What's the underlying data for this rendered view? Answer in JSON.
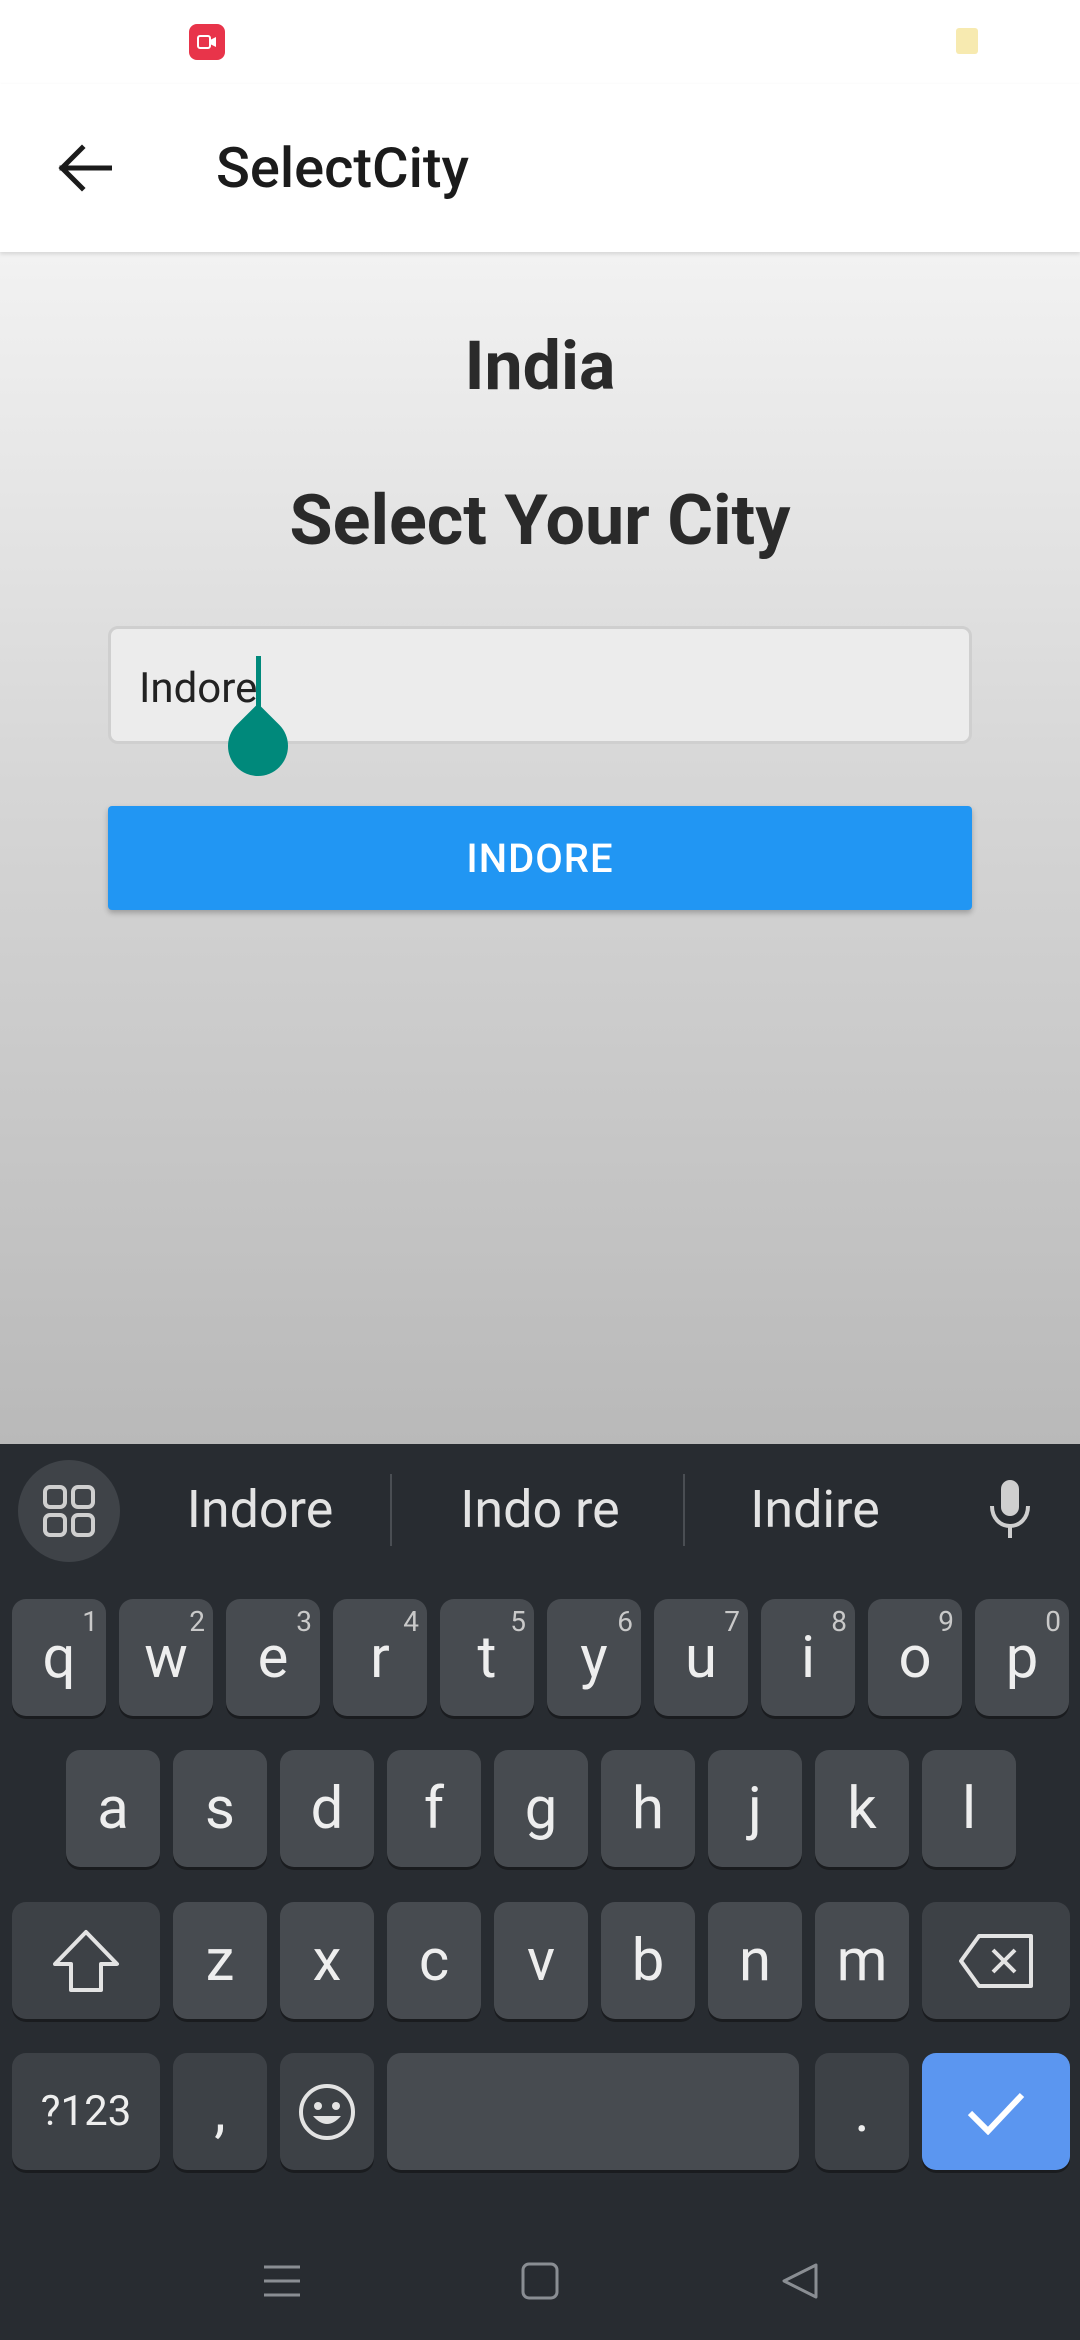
{
  "app_bar": {
    "title": "SelectCity"
  },
  "content": {
    "country": "India",
    "heading": "Select Your City",
    "input_value": "Indore",
    "button_label": "INDORE"
  },
  "keyboard": {
    "suggestions": [
      "Indore",
      "Indo re",
      "Indire"
    ],
    "row1": [
      {
        "k": "q",
        "h": "1"
      },
      {
        "k": "w",
        "h": "2"
      },
      {
        "k": "e",
        "h": "3"
      },
      {
        "k": "r",
        "h": "4"
      },
      {
        "k": "t",
        "h": "5"
      },
      {
        "k": "y",
        "h": "6"
      },
      {
        "k": "u",
        "h": "7"
      },
      {
        "k": "i",
        "h": "8"
      },
      {
        "k": "o",
        "h": "9"
      },
      {
        "k": "p",
        "h": "0"
      }
    ],
    "row2": [
      "a",
      "s",
      "d",
      "f",
      "g",
      "h",
      "j",
      "k",
      "l"
    ],
    "row3": [
      "z",
      "x",
      "c",
      "v",
      "b",
      "n",
      "m"
    ],
    "symbols_label": "?123",
    "comma": ",",
    "period": "."
  },
  "colors": {
    "accent": "#2196f3",
    "cursor": "#00897b",
    "keyboard_bg": "#282c31",
    "enter_key": "#5b96f0"
  }
}
